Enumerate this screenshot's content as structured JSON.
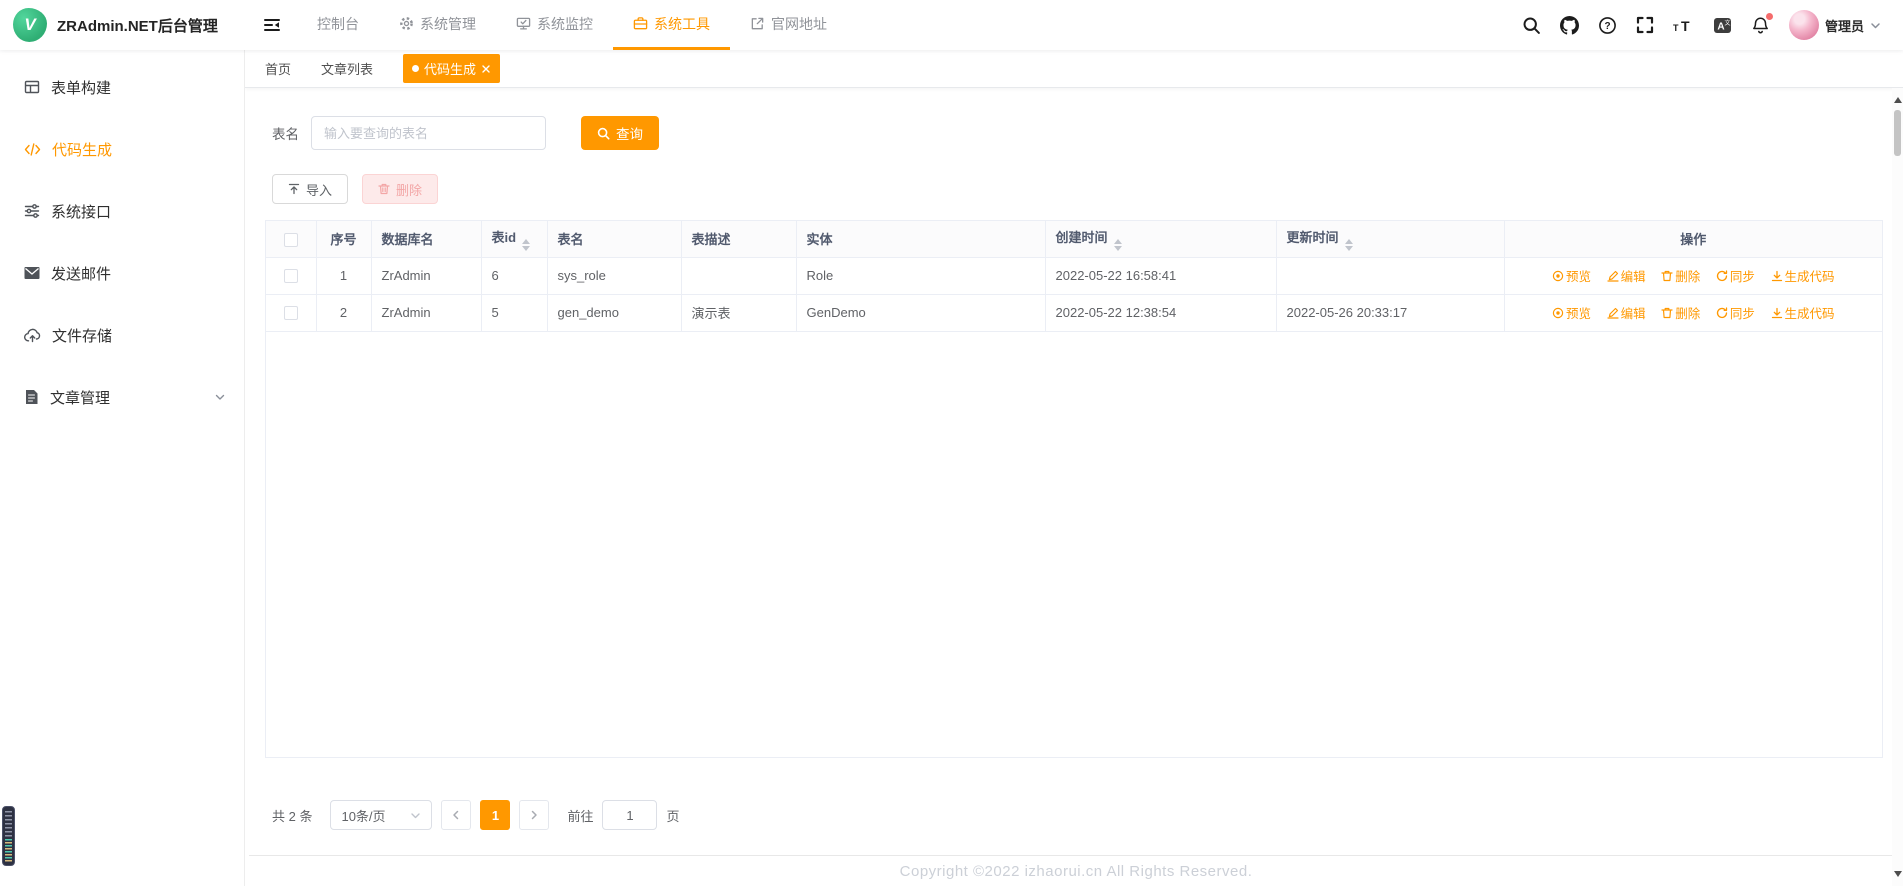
{
  "app": {
    "logo_letter": "V",
    "title": "ZRAdmin.NET后台管理"
  },
  "topnav": {
    "items": [
      {
        "label": "控制台",
        "icon": null,
        "active": false
      },
      {
        "label": "系统管理",
        "icon": "gear-icon",
        "active": false
      },
      {
        "label": "系统监控",
        "icon": "monitor-icon",
        "active": false
      },
      {
        "label": "系统工具",
        "icon": "toolbox-icon",
        "active": true
      },
      {
        "label": "官网地址",
        "icon": "external-link-icon",
        "active": false
      }
    ]
  },
  "header_actions": {
    "icons": [
      "search-icon",
      "github-icon",
      "help-icon",
      "fullscreen-icon",
      "font-size-icon",
      "language-icon",
      "notification-bell-icon"
    ],
    "user": {
      "name": "管理员"
    }
  },
  "tabs": [
    {
      "label": "首页",
      "active": false
    },
    {
      "label": "文章列表",
      "active": false
    },
    {
      "label": "代码生成",
      "active": true,
      "closable": true
    }
  ],
  "sidebar": {
    "items": [
      {
        "label": "表单构建",
        "icon": "form-builder-icon",
        "active": false
      },
      {
        "label": "代码生成",
        "icon": "code-icon",
        "active": true
      },
      {
        "label": "系统接口",
        "icon": "api-icon",
        "active": false
      },
      {
        "label": "发送邮件",
        "icon": "mail-icon",
        "active": false
      },
      {
        "label": "文件存储",
        "icon": "file-storage-icon",
        "active": false
      },
      {
        "label": "文章管理",
        "icon": "article-icon",
        "active": false,
        "expandable": true
      }
    ]
  },
  "search": {
    "label": "表名",
    "placeholder": "输入要查询的表名",
    "button": "查询"
  },
  "toolbar": {
    "import": "导入",
    "delete": "删除"
  },
  "table": {
    "columns": [
      "序号",
      "数据库名",
      "表id",
      "表名",
      "表描述",
      "实体",
      "创建时间",
      "更新时间",
      "操作"
    ],
    "sortable_columns": [
      "表id",
      "创建时间",
      "更新时间"
    ],
    "rows": [
      {
        "seq": "1",
        "db": "ZrAdmin",
        "table_id": "6",
        "name": "sys_role",
        "desc": "",
        "entity": "Role",
        "created": "2022-05-22 16:58:41",
        "updated": ""
      },
      {
        "seq": "2",
        "db": "ZrAdmin",
        "table_id": "5",
        "name": "gen_demo",
        "desc": "演示表",
        "entity": "GenDemo",
        "created": "2022-05-22 12:38:54",
        "updated": "2022-05-26 20:33:17"
      }
    ],
    "actions": [
      {
        "label": "预览",
        "icon": "preview-icon"
      },
      {
        "label": "编辑",
        "icon": "edit-icon"
      },
      {
        "label": "删除",
        "icon": "delete-icon"
      },
      {
        "label": "同步",
        "icon": "sync-icon"
      },
      {
        "label": "生成代码",
        "icon": "generate-code-icon"
      }
    ]
  },
  "pagination": {
    "total": "共 2 条",
    "page_size": "10条/页",
    "current_page": "1",
    "goto_label": "前往",
    "goto_value": "1",
    "page_unit": "页"
  },
  "footer": {
    "copyright": "Copyright ©2022 izhaorui.cn All Rights Reserved."
  },
  "colors": {
    "accent": "#ff9800",
    "logo_green": "#42b983",
    "notification_dot": "#f56c6c",
    "disabled_danger_bg": "#fdeaea",
    "disabled_danger_text": "#f3a6a6",
    "table_header_text": "#515a6e"
  }
}
